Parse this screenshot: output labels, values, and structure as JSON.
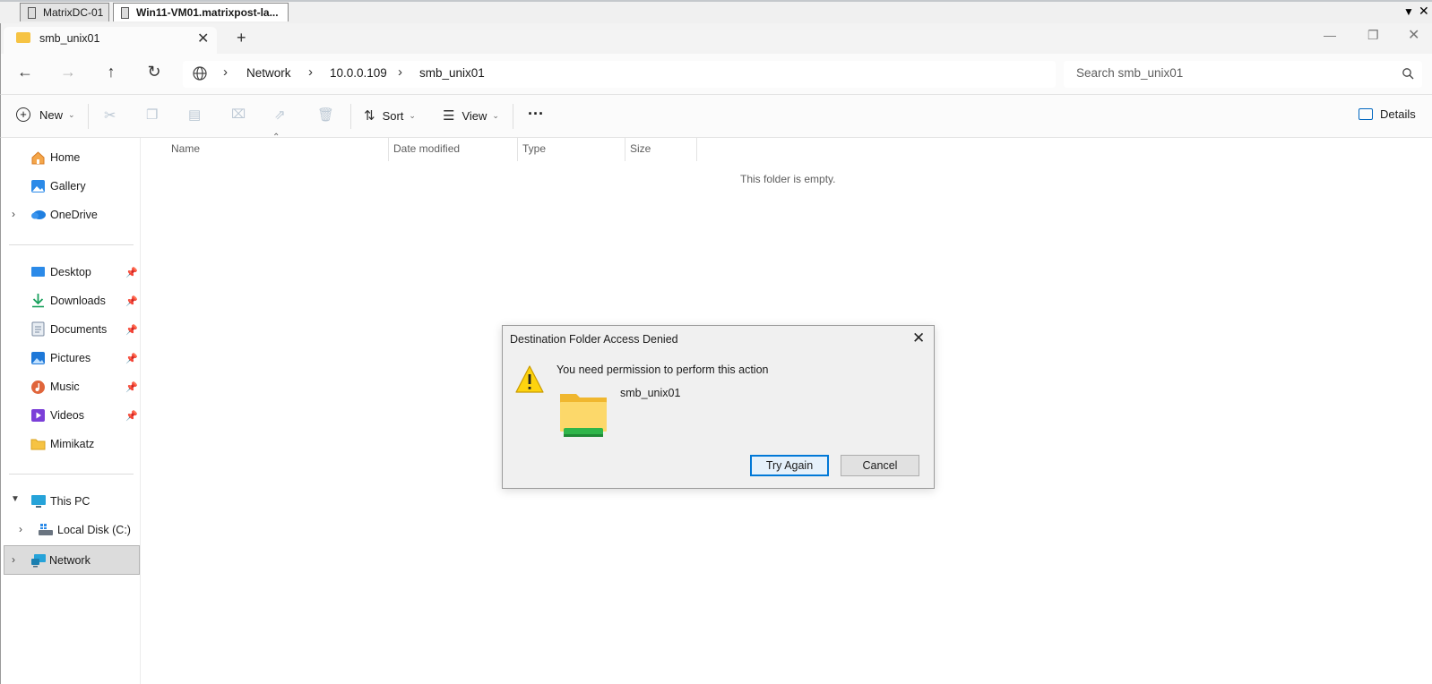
{
  "rdp": {
    "tabs": [
      {
        "label": "MatrixDC-01"
      },
      {
        "label": "Win11-VM01.matrixpost-la..."
      }
    ]
  },
  "explorer_tab": {
    "label": "smb_unix01"
  },
  "breadcrumb": [
    "Network",
    "10.0.0.109",
    "smb_unix01"
  ],
  "search": {
    "placeholder": "Search smb_unix01"
  },
  "toolbar": {
    "new_label": "New",
    "sort_label": "Sort",
    "view_label": "View",
    "more_label": "···",
    "details_label": "Details"
  },
  "sidebar": {
    "items": [
      {
        "label": "Home"
      },
      {
        "label": "Gallery"
      },
      {
        "label": "OneDrive"
      },
      {
        "label": "Desktop"
      },
      {
        "label": "Downloads"
      },
      {
        "label": "Documents"
      },
      {
        "label": "Pictures"
      },
      {
        "label": "Music"
      },
      {
        "label": "Videos"
      },
      {
        "label": "Mimikatz"
      },
      {
        "label": "This PC"
      },
      {
        "label": "Local Disk (C:)"
      },
      {
        "label": "Network"
      }
    ]
  },
  "columns": [
    "Name",
    "Date modified",
    "Type",
    "Size"
  ],
  "empty_text": "This folder is empty.",
  "dialog": {
    "title": "Destination Folder Access Denied",
    "message": "You need permission to perform this action",
    "item_name": "smb_unix01",
    "try_again": "Try Again",
    "cancel": "Cancel"
  },
  "colors": {
    "accent": "#0078d7",
    "folder": "#f6c343"
  }
}
